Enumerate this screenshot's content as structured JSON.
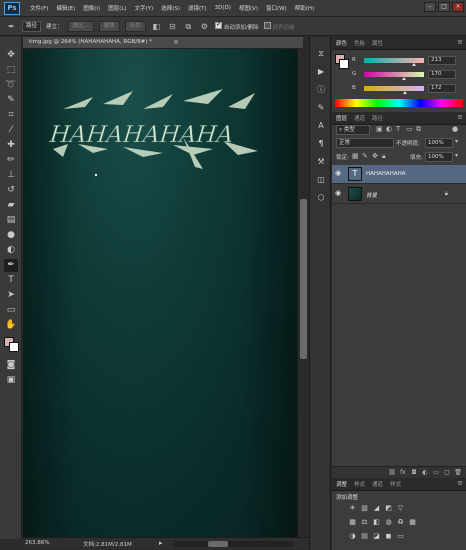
{
  "app": {
    "logo": "Ps"
  },
  "menu": [
    "文件(F)",
    "编辑(E)",
    "图像(I)",
    "图层(L)",
    "文字(Y)",
    "选择(S)",
    "滤镜(T)",
    "3D(D)",
    "视图(V)",
    "窗口(W)",
    "帮助(H)"
  ],
  "options": {
    "mode_select": "路径",
    "make_label": "建立：",
    "selection_btn": "选区...",
    "mask_btn": "蒙版",
    "shape_btn": "形状",
    "auto_add_delete": "自动添加/删除",
    "align_edges": "对齐边缘"
  },
  "document": {
    "tab_title": "timg.jpg @ 264% (HAHAHAHAHA, RGB/8#) *",
    "art_text": "HAHAHAHAHA",
    "zoom": "263.86%",
    "doc_size": "文档:2.81M/2.81M"
  },
  "color_panel": {
    "tabs": [
      "颜色",
      "色板",
      "属性"
    ],
    "channels": [
      {
        "label": "R",
        "value": "213",
        "level": 0.835,
        "from": "#00b1ac",
        "to": "#ffb1ac"
      },
      {
        "label": "G",
        "value": "170",
        "level": 0.667,
        "from": "#d500ac",
        "to": "#d5ffac"
      },
      {
        "label": "B",
        "value": "172",
        "level": 0.675,
        "from": "#d5b100",
        "to": "#d5b1ff"
      }
    ],
    "foreground": "#d5aaac"
  },
  "layers_panel": {
    "tabs": [
      "图层",
      "通道",
      "路径"
    ],
    "filter": "类型",
    "blend_mode": "正常",
    "opacity_label": "不透明度:",
    "opacity": "100%",
    "lock_label": "锁定:",
    "fill_label": "填充:",
    "fill": "100%",
    "layers": [
      {
        "name": "HAHAHAHAHA",
        "type": "text",
        "selected": true
      },
      {
        "name": "背景",
        "type": "image",
        "selected": false,
        "locked": true
      }
    ]
  },
  "adjustments_panel": {
    "tabs": [
      "调整",
      "样式",
      "通道",
      "样式"
    ],
    "title": "添加调整"
  }
}
